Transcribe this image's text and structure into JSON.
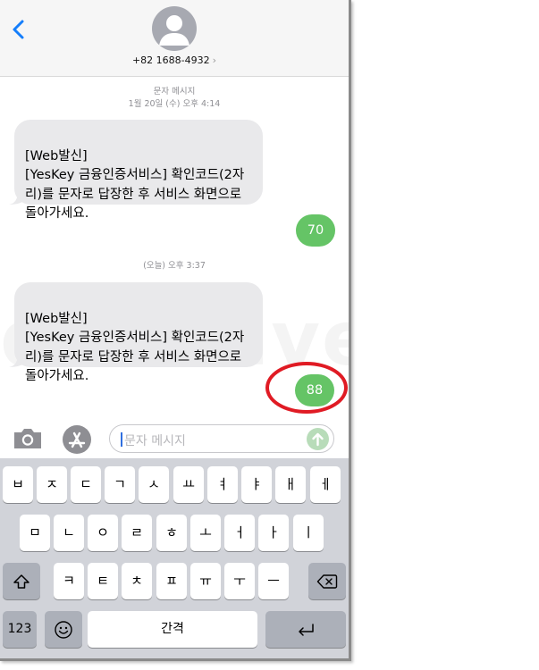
{
  "header": {
    "contact_number": "+82 1688-4932",
    "contact_chevron": "›"
  },
  "thread": {
    "service_label": "문자 메시지",
    "first_timestamp": "1월 20일 (수) 오후 4:14",
    "second_timestamp": "(오늘) 오후 3:37",
    "messages": [
      {
        "direction": "incoming",
        "text": "[Web발신]\n[YesKey 금융인증서비스] 확인코드(2자리)를 문자로 답장한 후 서비스 화면으로 돌아가세요."
      },
      {
        "direction": "outgoing",
        "text": "70"
      },
      {
        "direction": "incoming",
        "text": "[Web발신]\n[YesKey 금융인증서비스] 확인코드(2자리)를 문자로 답장한 후 서비스 화면으로 돌아가세요."
      },
      {
        "direction": "outgoing",
        "text": "88"
      }
    ],
    "watermark": "dadalive"
  },
  "input": {
    "placeholder": "문자 메시지"
  },
  "keyboard": {
    "row1": [
      "ㅂ",
      "ㅈ",
      "ㄷ",
      "ㄱ",
      "ㅅ",
      "ㅛ",
      "ㅕ",
      "ㅑ",
      "ㅐ",
      "ㅔ"
    ],
    "row2": [
      "ㅁ",
      "ㄴ",
      "ㅇ",
      "ㄹ",
      "ㅎ",
      "ㅗ",
      "ㅓ",
      "ㅏ",
      "ㅣ"
    ],
    "row3": [
      "ㅋ",
      "ㅌ",
      "ㅊ",
      "ㅍ",
      "ㅠ",
      "ㅜ",
      "ㅡ"
    ],
    "numbers_key": "123",
    "space_key": "간격"
  },
  "icons": {
    "back": "chevron-left-icon",
    "avatar": "person-icon",
    "camera": "camera-icon",
    "appstore": "app-store-icon",
    "send": "arrow-up-icon",
    "shift": "shift-icon",
    "delete": "backspace-icon",
    "emoji": "emoji-icon",
    "return": "return-icon"
  },
  "colors": {
    "accent": "#147efb",
    "outgoing_bubble": "#65c466",
    "incoming_bubble": "#e9e9eb",
    "highlight": "#e01b24"
  }
}
